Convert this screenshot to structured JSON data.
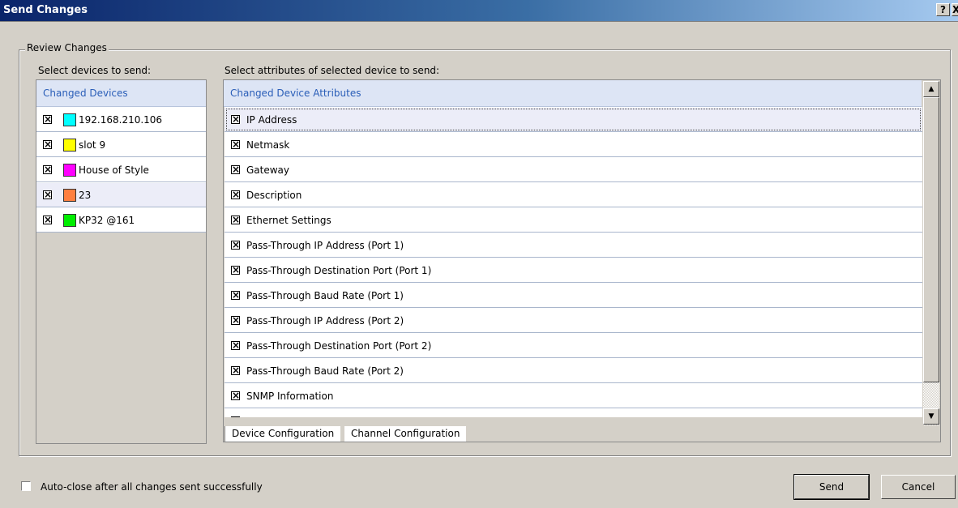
{
  "window": {
    "title": "Send Changes",
    "help_glyph": "?",
    "close_glyph": "X"
  },
  "group": {
    "label": "Review Changes"
  },
  "devices": {
    "label": "Select devices to send:",
    "header": "Changed Devices",
    "items": [
      {
        "name": "192.168.210.106",
        "color": "#00ffff",
        "checked": true
      },
      {
        "name": "slot 9",
        "color": "#ffff00",
        "checked": true
      },
      {
        "name": "House of Style",
        "color": "#ff00ff",
        "checked": true
      },
      {
        "name": "23",
        "color": "#ff7f3f",
        "checked": true
      },
      {
        "name": "KP32 @161",
        "color": "#00ee00",
        "checked": true
      }
    ]
  },
  "attributes": {
    "label": "Select attributes of selected device to send:",
    "header": "Changed Device Attributes",
    "items": [
      {
        "name": "IP Address",
        "checked": true
      },
      {
        "name": "Netmask",
        "checked": true
      },
      {
        "name": "Gateway",
        "checked": true
      },
      {
        "name": "Description",
        "checked": true
      },
      {
        "name": "Ethernet Settings",
        "checked": true
      },
      {
        "name": "Pass-Through IP Address (Port 1)",
        "checked": true
      },
      {
        "name": "Pass-Through Destination Port (Port 1)",
        "checked": true
      },
      {
        "name": "Pass-Through Baud Rate (Port 1)",
        "checked": true
      },
      {
        "name": "Pass-Through IP Address (Port 2)",
        "checked": true
      },
      {
        "name": "Pass-Through Destination Port (Port 2)",
        "checked": true
      },
      {
        "name": "Pass-Through Baud Rate (Port 2)",
        "checked": true
      },
      {
        "name": "SNMP Information",
        "checked": true
      },
      {
        "name": "",
        "checked": true
      }
    ],
    "tabs": [
      "Device Configuration",
      "Channel Configuration"
    ]
  },
  "footer": {
    "autoclose_label": "Auto-close after all changes sent successfully",
    "autoclose_checked": false,
    "send_label": "Send",
    "cancel_label": "Cancel"
  }
}
